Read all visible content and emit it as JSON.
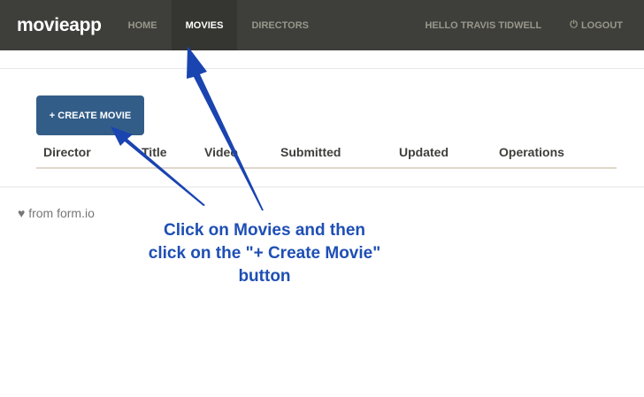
{
  "navbar": {
    "brand": "movieapp",
    "items": [
      {
        "label": "HOME"
      },
      {
        "label": "MOVIES",
        "active": true
      },
      {
        "label": "DIRECTORS"
      }
    ],
    "greeting": "HELLO TRAVIS TIDWELL",
    "logout": "LOGOUT",
    "logout_icon": "power-icon"
  },
  "main": {
    "create_button": "+ CREATE MOVIE",
    "columns": [
      "Director",
      "Title",
      "Video",
      "Submitted",
      "Updated",
      "Operations"
    ]
  },
  "footer": {
    "icon": "heart-icon",
    "text": "from form.io"
  },
  "annotation": {
    "lines": [
      "Click on Movies and then",
      "click on the \"+ Create Movie\"",
      "button"
    ],
    "color": "#1e4fb4"
  },
  "colors": {
    "navbar": "#3e3f3a",
    "primary": "#325d88"
  }
}
